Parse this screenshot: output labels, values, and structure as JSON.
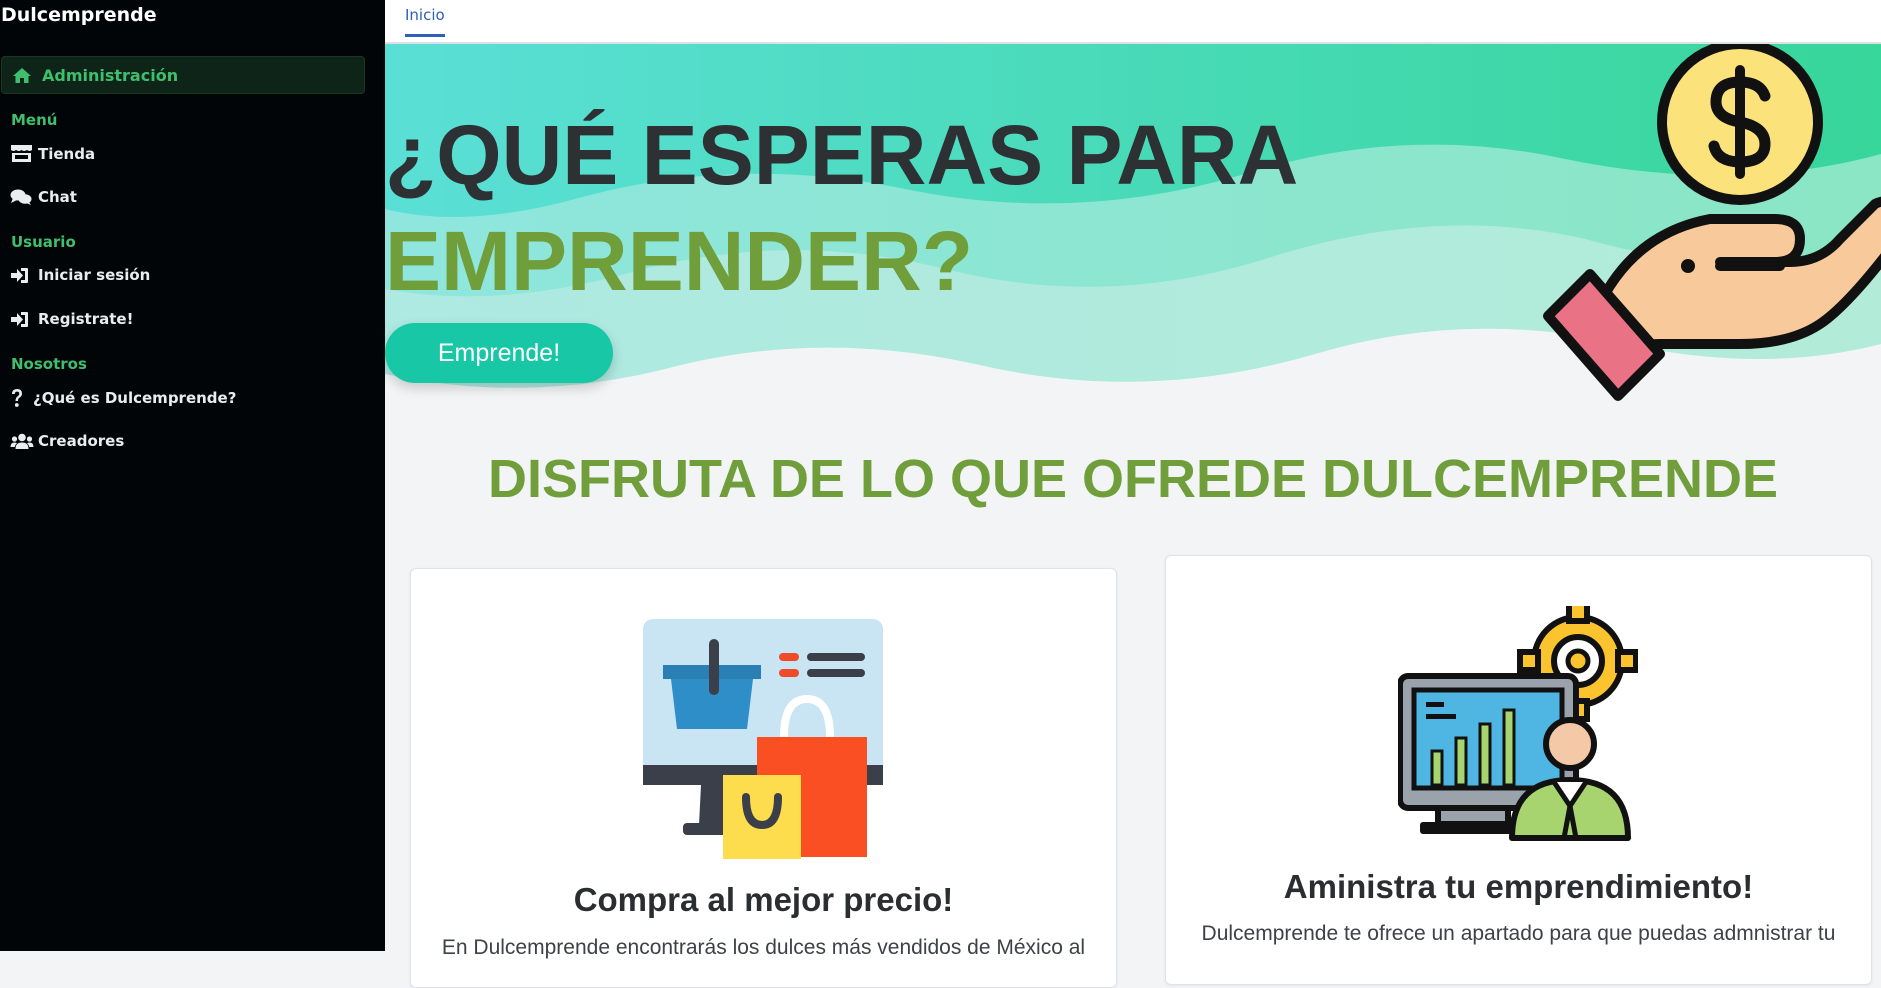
{
  "sidebar": {
    "brand": "Dulcemprende",
    "active_item": {
      "label": "Administración",
      "icon": "home-icon"
    },
    "sections": [
      {
        "label": "Menú",
        "items": [
          {
            "label": "Tienda",
            "icon": "store-icon"
          },
          {
            "label": "Chat",
            "icon": "chat-icon"
          }
        ]
      },
      {
        "label": "Usuario",
        "items": [
          {
            "label": "Iniciar sesión",
            "icon": "sign-in-icon"
          },
          {
            "label": "Registrate!",
            "icon": "sign-in-icon"
          }
        ]
      },
      {
        "label": "Nosotros",
        "items": [
          {
            "label": "¿Qué es Dulcemprende?",
            "icon": "question-icon"
          },
          {
            "label": "Creadores",
            "icon": "users-icon"
          }
        ]
      }
    ]
  },
  "topbar": {
    "tab": "Inicio"
  },
  "hero": {
    "title_line1": "¿QUÉ ESPERAS PARA",
    "title_line2": "EMPRENDER?",
    "cta_label": "Emprende!"
  },
  "features": {
    "heading": "DISFRUTA DE LO QUE OFREDE DULCEMPRENDE",
    "cards": [
      {
        "title": "Compra al mejor precio!",
        "text": "En Dulcemprende encontrarás los dulces más vendidos de México al",
        "icon": "shopping-monitor-icon"
      },
      {
        "title": "Aministra tu emprendimiento!",
        "text": "Dulcemprende te ofrece un apartado para que puedas admnistrar tu",
        "icon": "admin-dashboard-icon"
      }
    ]
  },
  "colors": {
    "sidebar_bg": "#020508",
    "accent_green": "#3fbf6e",
    "heading_green": "#6f9e3a",
    "cta": "#18c7a6",
    "link_blue": "#2f5fb8"
  }
}
